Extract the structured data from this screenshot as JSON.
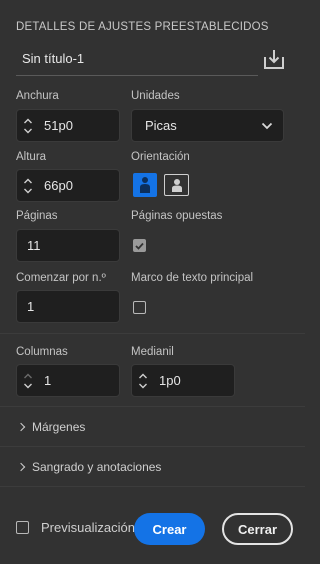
{
  "preset": {
    "section_title": "DETALLES DE AJUSTES PREESTABLECIDOS",
    "name": "Sin título-1",
    "save_icon": "save-preset-icon"
  },
  "fields": {
    "width": {
      "label": "Anchura",
      "value": "51p0"
    },
    "units": {
      "label": "Unidades",
      "value": "Picas"
    },
    "height": {
      "label": "Altura",
      "value": "66p0"
    },
    "orientation": {
      "label": "Orientación",
      "selected": "portrait"
    },
    "pages": {
      "label": "Páginas",
      "value": "11"
    },
    "facing_pages": {
      "label": "Páginas opuestas",
      "checked": true
    },
    "start_at": {
      "label": "Comenzar por n.º",
      "value": "1"
    },
    "primary_text_frame": {
      "label": "Marco de texto principal",
      "checked": false
    },
    "columns": {
      "label": "Columnas",
      "value": "1"
    },
    "gutter": {
      "label": "Medianil",
      "value": "1p0"
    }
  },
  "sections": {
    "margins": "Márgenes",
    "bleed": "Sangrado y anotaciones"
  },
  "footer": {
    "preview_label": "Previsualización",
    "preview_checked": false,
    "create_label": "Crear",
    "close_label": "Cerrar"
  },
  "colors": {
    "background": "#323232",
    "field": "#1f1f1f",
    "accent": "#1473e6"
  }
}
